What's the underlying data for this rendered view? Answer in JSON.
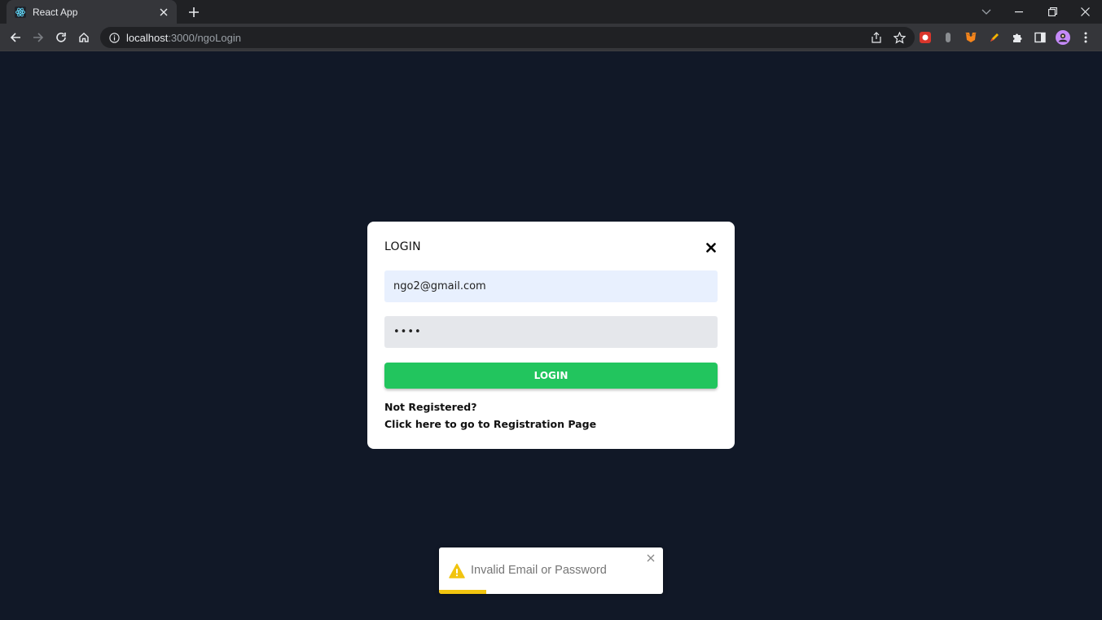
{
  "browser": {
    "tab": {
      "title": "React App",
      "favicon": "react-icon"
    },
    "url": {
      "host": "localhost",
      "path": ":3000/ngoLogin"
    },
    "icons": {
      "back": "arrow-left-icon",
      "forward": "arrow-right-icon",
      "reload": "reload-icon",
      "home": "home-icon",
      "info": "info-icon",
      "share": "share-icon",
      "bookmark": "star-icon",
      "extensions": "puzzle-icon",
      "sidepanel": "sidepanel-icon",
      "profile": "avatar",
      "menu": "kebab-menu-icon"
    }
  },
  "login": {
    "title": "LOGIN",
    "email_value": "ngo2@gmail.com",
    "password_mask": "••••",
    "button_label": "LOGIN",
    "not_registered": "Not Registered?",
    "register_link": "Click here to go to Registration Page"
  },
  "toast": {
    "message": "Invalid Email or Password",
    "type": "warning",
    "progress": 0.21
  },
  "colors": {
    "page_bg": "#111827",
    "accent_green": "#22c55e",
    "warning_yellow": "#f1c40f",
    "email_bg": "#e8f0fe",
    "password_bg": "#e5e7eb"
  }
}
